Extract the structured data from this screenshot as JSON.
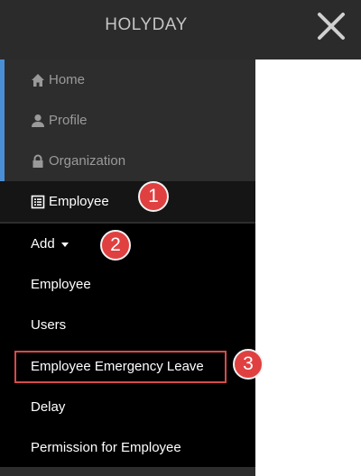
{
  "header": {
    "title": "HOLYDAY",
    "close_icon": "close-icon"
  },
  "sidebar": {
    "items": [
      {
        "label": "Home",
        "icon": "home-icon"
      },
      {
        "label": "Profile",
        "icon": "user-icon"
      },
      {
        "label": "Organization",
        "icon": "lock-icon"
      },
      {
        "label": "Employee",
        "icon": "list-icon",
        "active": true
      }
    ],
    "submenu": [
      {
        "label": "Add"
      },
      {
        "label": "Employee"
      },
      {
        "label": "Users"
      },
      {
        "label": "Employee Emergency Leave"
      },
      {
        "label": "Delay"
      },
      {
        "label": "Permission for Employee"
      }
    ]
  },
  "annotations": {
    "badge1": "1",
    "badge2": "2",
    "badge3": "3"
  },
  "colors": {
    "accent": "#4a8fd6",
    "badge": "#e04040",
    "header": "#2b2b2b"
  }
}
